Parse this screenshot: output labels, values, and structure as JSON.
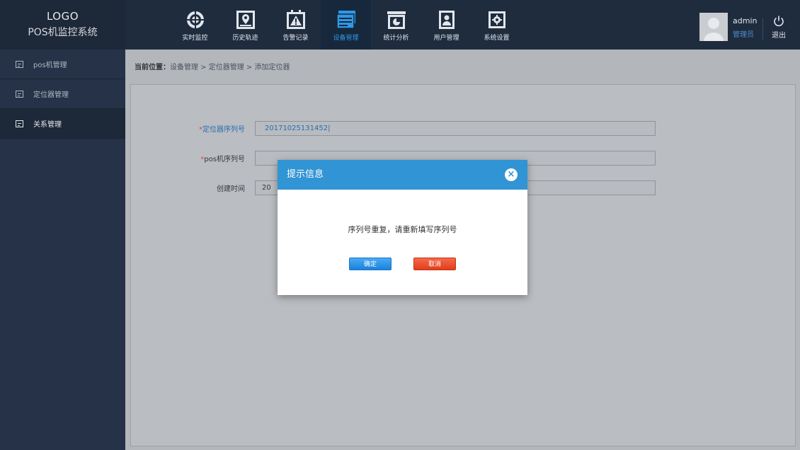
{
  "logo": {
    "line1": "LOGO",
    "line2": "POS机监控系统"
  },
  "nav": [
    {
      "label": "实时监控",
      "icon": "target-icon"
    },
    {
      "label": "历史轨迹",
      "icon": "map-pin-icon"
    },
    {
      "label": "告警记录",
      "icon": "warning-icon"
    },
    {
      "label": "设备管理",
      "icon": "device-icon",
      "active": true
    },
    {
      "label": "统计分析",
      "icon": "chart-icon"
    },
    {
      "label": "用户管理",
      "icon": "user-card-icon"
    },
    {
      "label": "系统设置",
      "icon": "gear-icon"
    }
  ],
  "user": {
    "name": "admin",
    "role": "管理员",
    "logout": "退出"
  },
  "sidebar": [
    {
      "label": "pos机管理"
    },
    {
      "label": "定位器管理"
    },
    {
      "label": "关系管理",
      "active": true
    }
  ],
  "breadcrumb": {
    "label": "当前位置：",
    "path": "设备管理 > 定位器管理 > 添加定位器"
  },
  "form": {
    "locator_serial": {
      "label": "定位器序列号",
      "value": "20171025131452|"
    },
    "pos_serial": {
      "label": "pos机序列号",
      "value": ""
    },
    "create_time": {
      "label": "创建时间",
      "value": "20"
    }
  },
  "modal": {
    "title": "提示信息",
    "close": "×",
    "message": "序列号重复，请重新填写序列号",
    "ok": "确定",
    "cancel": "取消"
  },
  "colors": {
    "accent": "#3194d4",
    "danger": "#e23d1c",
    "active_nav": "#2e98e6"
  }
}
